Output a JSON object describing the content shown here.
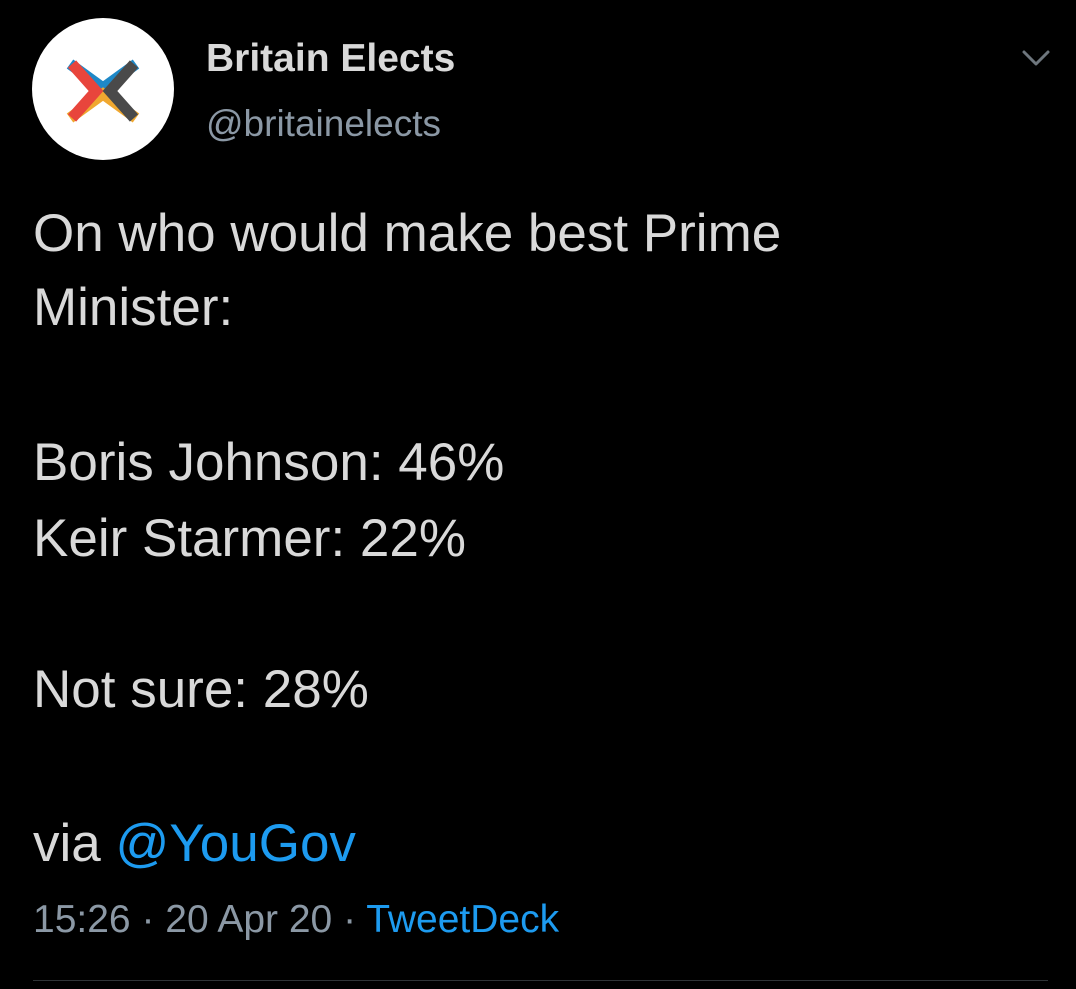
{
  "author": {
    "name": "Britain Elects",
    "handle": "@britainelects",
    "avatar_icon": "britain-elects-logo-icon"
  },
  "menu": {
    "icon": "chevron-down-icon"
  },
  "tweet": {
    "line1": "On who would make best Prime",
    "line2": "Minister:",
    "line3": "Boris Johnson: 46%",
    "line4": "Keir Starmer: 22%",
    "line5": "Not sure: 28%",
    "via_prefix": "via ",
    "mention": "@YouGov"
  },
  "meta": {
    "time": "15:26",
    "sep1": " · ",
    "date": "20 Apr 20",
    "sep2": " · ",
    "app": "TweetDeck"
  },
  "colors": {
    "background": "#000000",
    "text": "#d9d9d9",
    "secondary": "#8b98a5",
    "link": "#1d9bf0",
    "logo_red": "#e8453c",
    "logo_blue": "#1e88c7",
    "logo_orange": "#f0a830",
    "logo_grey": "#4a4a4a"
  }
}
